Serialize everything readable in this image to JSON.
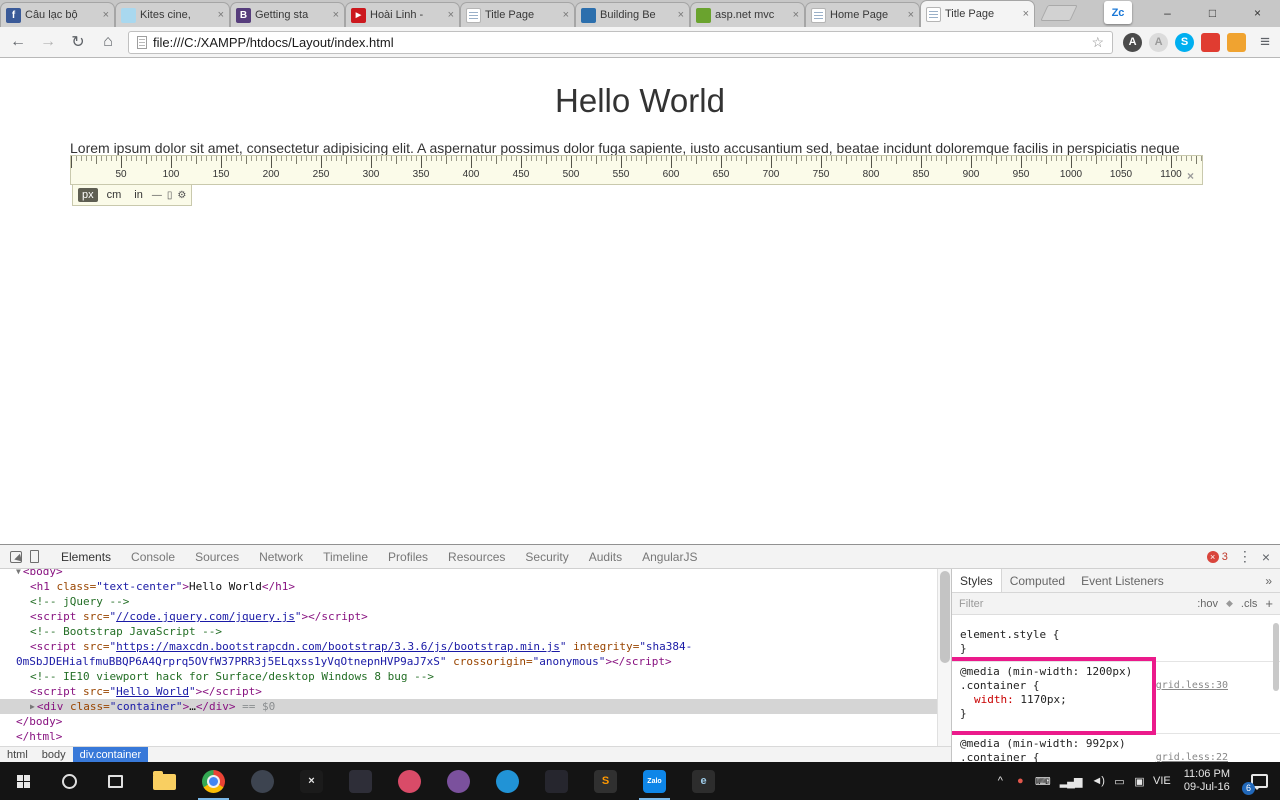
{
  "tabbar": {
    "tabs": [
      {
        "title": "Câu lạc bộ",
        "icon": "facebook",
        "icon_bg": "#3a5a98",
        "glyph": "f",
        "glyph_color": "#ffffff",
        "active": false
      },
      {
        "title": "Kites cine,",
        "icon": "kites",
        "icon_bg": "#a9d8ef",
        "glyph": "",
        "glyph_color": "#ffffff",
        "active": false
      },
      {
        "title": "Getting sta",
        "icon": "bootstrap",
        "icon_bg": "#563d7c",
        "glyph": "B",
        "glyph_color": "#ffffff",
        "active": false
      },
      {
        "title": "Hoài Linh -",
        "icon": "youtube",
        "icon_bg": "#cc181e",
        "glyph": "▶",
        "glyph_color": "#ffffff",
        "active": false
      },
      {
        "title": "Title Page",
        "icon": "page",
        "icon_bg": "#ffffff",
        "glyph": "",
        "glyph_color": "#888888",
        "active": false
      },
      {
        "title": "Building Be",
        "icon": "building",
        "icon_bg": "#2c6fad",
        "glyph": "",
        "glyph_color": "#ffffff",
        "active": false
      },
      {
        "title": "asp.net mvc",
        "icon": "aspnet",
        "icon_bg": "#6aa32e",
        "glyph": "",
        "glyph_color": "#ffffff",
        "active": false
      },
      {
        "title": "Home Page",
        "icon": "page",
        "icon_bg": "#ffffff",
        "glyph": "",
        "glyph_color": "#888888",
        "active": false
      },
      {
        "title": "Title Page",
        "icon": "page",
        "icon_bg": "#ffffff",
        "glyph": "",
        "glyph_color": "#888888",
        "active": true
      }
    ],
    "widget_label": "Zc",
    "window_controls": [
      {
        "name": "minimize-button",
        "glyph": "–"
      },
      {
        "name": "maximize-button",
        "glyph": "□"
      },
      {
        "name": "close-button",
        "glyph": "×"
      }
    ]
  },
  "toolbar": {
    "back": "←",
    "forward": "→",
    "refresh": "↻",
    "home": "⌂",
    "url": "file:///C:/XAMPP/htdocs/Layout/index.html",
    "bookmark_star": "☆",
    "menu": "≡",
    "extensions": [
      {
        "name": "extension-a-dark-icon",
        "glyph": "A",
        "bg": "#4a4a4a",
        "fg": "#ffffff",
        "shape": "circle"
      },
      {
        "name": "extension-a-gray-icon",
        "glyph": "A",
        "bg": "#dcdcdc",
        "fg": "#9a9a9a",
        "shape": "circle"
      },
      {
        "name": "skype-extension-icon",
        "glyph": "S",
        "bg": "#00aff0",
        "fg": "#ffffff",
        "shape": "circle"
      },
      {
        "name": "extension-red-icon",
        "glyph": "",
        "bg": "#e03c31",
        "fg": "#ffffff",
        "shape": "square"
      },
      {
        "name": "idm-extension-icon",
        "glyph": "",
        "bg": "#f0a330",
        "fg": "#ffffff",
        "shape": "square"
      }
    ]
  },
  "page": {
    "heading": "Hello World",
    "paragraph": "Lorem ipsum dolor sit amet, consectetur adipisicing elit. A aspernatur possimus dolor fuga sapiente, iusto accusantium sed, beatae incidunt doloremque facilis in perspiciatis neque"
  },
  "ruler": {
    "labels": [
      50,
      100,
      150,
      200,
      250,
      300,
      350,
      400,
      450,
      500,
      550,
      600,
      650,
      700,
      750,
      800,
      850,
      900,
      950,
      1000,
      1050,
      1100
    ],
    "units": [
      {
        "label": "px",
        "selected": true
      },
      {
        "label": "cm",
        "selected": false
      },
      {
        "label": "in",
        "selected": false
      }
    ],
    "tool_icons": [
      {
        "name": "ruler-line-icon",
        "glyph": "—"
      },
      {
        "name": "ruler-device-icon",
        "glyph": "▯"
      },
      {
        "name": "ruler-settings-icon",
        "glyph": "⚙"
      }
    ],
    "close": "×"
  },
  "devtools": {
    "tabs": [
      {
        "label": "Elements",
        "selected": true
      },
      {
        "label": "Console",
        "selected": false
      },
      {
        "label": "Sources",
        "selected": false
      },
      {
        "label": "Network",
        "selected": false
      },
      {
        "label": "Timeline",
        "selected": false
      },
      {
        "label": "Profiles",
        "selected": false
      },
      {
        "label": "Resources",
        "selected": false
      },
      {
        "label": "Security",
        "selected": false
      },
      {
        "label": "Audits",
        "selected": false
      },
      {
        "label": "AngularJS",
        "selected": false
      }
    ],
    "error_count": "3",
    "menu_dots": "⋮",
    "close": "×",
    "dom_lines": [
      {
        "indent": 0,
        "selected": false,
        "tokens": [
          {
            "c": "arrow",
            "s": "▼"
          },
          {
            "c": "tag",
            "s": "<body>"
          }
        ]
      },
      {
        "indent": 1,
        "selected": false,
        "tokens": [
          {
            "c": "tag",
            "s": "<h1"
          },
          {
            "c": "attr",
            "s": " class"
          },
          {
            "c": "attr",
            "s": "="
          },
          {
            "c": "value",
            "s": "\"text-center\""
          },
          {
            "c": "tag",
            "s": ">"
          },
          {
            "c": "text",
            "s": "Hello World"
          },
          {
            "c": "tag",
            "s": "</h1>"
          }
        ]
      },
      {
        "indent": 1,
        "selected": false,
        "tokens": [
          {
            "c": "comment",
            "s": "<!-- jQuery -->"
          }
        ]
      },
      {
        "indent": 1,
        "selected": false,
        "tokens": [
          {
            "c": "tag",
            "s": "<script"
          },
          {
            "c": "attr",
            "s": " src"
          },
          {
            "c": "attr",
            "s": "="
          },
          {
            "c": "value",
            "s": "\""
          },
          {
            "c": "link",
            "s": "//code.jquery.com/jquery.js"
          },
          {
            "c": "value",
            "s": "\""
          },
          {
            "c": "tag",
            "s": "></script>"
          }
        ]
      },
      {
        "indent": 1,
        "selected": false,
        "tokens": [
          {
            "c": "comment",
            "s": "<!-- Bootstrap JavaScript -->"
          }
        ]
      },
      {
        "indent": 1,
        "selected": false,
        "tokens": [
          {
            "c": "tag",
            "s": "<script"
          },
          {
            "c": "attr",
            "s": " src"
          },
          {
            "c": "attr",
            "s": "="
          },
          {
            "c": "value",
            "s": "\""
          },
          {
            "c": "link",
            "s": "https://maxcdn.bootstrapcdn.com/bootstrap/3.3.6/js/bootstrap.min.js"
          },
          {
            "c": "value",
            "s": "\""
          },
          {
            "c": "attr",
            "s": " integrity"
          },
          {
            "c": "attr",
            "s": "="
          },
          {
            "c": "value",
            "s": "\"sha384-"
          }
        ]
      },
      {
        "indent": 0,
        "selected": false,
        "tokens": [
          {
            "c": "value",
            "s": "0mSbJDEHialfmuBBQP6A4Qrprq5OVfW37PRR3j5ELqxss1yVqOtnepnHVP9aJ7xS\""
          },
          {
            "c": "attr",
            "s": " crossorigin"
          },
          {
            "c": "attr",
            "s": "="
          },
          {
            "c": "value",
            "s": "\"anonymous\""
          },
          {
            "c": "tag",
            "s": "></script>"
          }
        ]
      },
      {
        "indent": 1,
        "selected": false,
        "tokens": [
          {
            "c": "comment",
            "s": "<!-- IE10 viewport hack for Surface/desktop Windows 8 bug -->"
          }
        ]
      },
      {
        "indent": 1,
        "selected": false,
        "tokens": [
          {
            "c": "tag",
            "s": "<script"
          },
          {
            "c": "attr",
            "s": " src"
          },
          {
            "c": "attr",
            "s": "="
          },
          {
            "c": "value",
            "s": "\""
          },
          {
            "c": "link",
            "s": "Hello World"
          },
          {
            "c": "value",
            "s": "\""
          },
          {
            "c": "tag",
            "s": "></script>"
          }
        ]
      },
      {
        "indent": 1,
        "selected": true,
        "tokens": [
          {
            "c": "arrow",
            "s": "▶"
          },
          {
            "c": "tag",
            "s": "<div"
          },
          {
            "c": "attr",
            "s": " class"
          },
          {
            "c": "attr",
            "s": "="
          },
          {
            "c": "value",
            "s": "\"container\""
          },
          {
            "c": "tag",
            "s": ">"
          },
          {
            "c": "text",
            "s": "…"
          },
          {
            "c": "tag",
            "s": "</div>"
          },
          {
            "c": "gray",
            "s": " == $0"
          }
        ]
      },
      {
        "indent": 0,
        "selected": false,
        "tokens": [
          {
            "c": "tag",
            "s": "</body>"
          }
        ]
      },
      {
        "indent": 0,
        "selected": false,
        "tokens": [
          {
            "c": "tag",
            "s": "</html>"
          }
        ]
      }
    ],
    "breadcrumb": [
      {
        "label": "html",
        "selected": false
      },
      {
        "label": "body",
        "selected": false
      },
      {
        "label": "div.container",
        "selected": true
      }
    ],
    "styles": {
      "tabs": [
        {
          "label": "Styles",
          "selected": true
        },
        {
          "label": "Computed",
          "selected": false
        },
        {
          "label": "Event Listeners",
          "selected": false
        }
      ],
      "overflow": "»",
      "filter_placeholder": "Filter",
      "pseudo_toggle": ":hov",
      "color_icon": "◆",
      "class_toggle": ".cls",
      "add_rule": "+",
      "element_style": {
        "open": "element.style {",
        "close": "}"
      },
      "media_rule_1200": {
        "media": "@media (min-width: 1200px)",
        "selector": ".container {",
        "prop_name": "width:",
        "prop_value": "1170px;",
        "close": "}",
        "link": "grid.less:30"
      },
      "media_rule_992": {
        "media": "@media (min-width: 992px)",
        "selector": ".container {",
        "link": "grid.less:22"
      }
    }
  },
  "taskbar": {
    "pinned": [
      {
        "name": "file-explorer-icon",
        "type": "folder",
        "bg": "",
        "glyph": "",
        "fg": "",
        "running": false
      },
      {
        "name": "chrome-icon",
        "type": "chrome",
        "bg": "",
        "glyph": "",
        "fg": "",
        "running": true
      },
      {
        "name": "browser-app-icon",
        "type": "circle",
        "bg": "#3d4450",
        "glyph": "",
        "fg": "#ffffff",
        "running": false
      },
      {
        "name": "x-app-icon",
        "type": "square",
        "bg": "#1b1b1b",
        "glyph": "×",
        "fg": "#e8e8e8",
        "running": false
      },
      {
        "name": "dark-app-icon",
        "type": "square",
        "bg": "#2e2e38",
        "glyph": "",
        "fg": "#ffffff",
        "running": false
      },
      {
        "name": "pink-app-icon",
        "type": "circle",
        "bg": "#d94b68",
        "glyph": "",
        "fg": "#ffffff",
        "running": false
      },
      {
        "name": "viber-icon",
        "type": "circle",
        "bg": "#7b519d",
        "glyph": "",
        "fg": "#ffffff",
        "running": false
      },
      {
        "name": "blue-app-icon",
        "type": "circle",
        "bg": "#2193d6",
        "glyph": "",
        "fg": "#ffffff",
        "running": false
      },
      {
        "name": "ide-app-icon",
        "type": "square",
        "bg": "#26262e",
        "glyph": "",
        "fg": "#ffffff",
        "running": false
      },
      {
        "name": "sublime-icon",
        "type": "square",
        "bg": "#303030",
        "glyph": "S",
        "fg": "#ff9800",
        "running": false
      },
      {
        "name": "zalo-icon",
        "type": "square",
        "bg": "#0e86e8",
        "glyph": "Zalo",
        "fg": "#ffffff",
        "running": true
      },
      {
        "name": "edge-app-icon",
        "type": "square",
        "bg": "#2d2d2d",
        "glyph": "e",
        "fg": "#9ecbe8",
        "running": false
      }
    ],
    "tray": [
      {
        "name": "hidden-icons-button",
        "glyph": "^",
        "color": "#e6e6e6"
      },
      {
        "name": "tray-app-icon",
        "glyph": "●",
        "color": "#e2574c"
      },
      {
        "name": "touch-keyboard-icon",
        "glyph": "⌨",
        "color": "#e6e6e6"
      },
      {
        "name": "network-icon",
        "glyph": "▂▄▆",
        "color": "#e6e6e6"
      },
      {
        "name": "volume-icon",
        "glyph": "◄)",
        "color": "#e6e6e6"
      },
      {
        "name": "power-icon",
        "glyph": "▭",
        "color": "#e6e6e6"
      },
      {
        "name": "display-icon",
        "glyph": "▣",
        "color": "#e6e6e6"
      }
    ],
    "language": "VIE",
    "time": "11:06 PM",
    "date": "09-Jul-16",
    "notification_count": "6"
  }
}
